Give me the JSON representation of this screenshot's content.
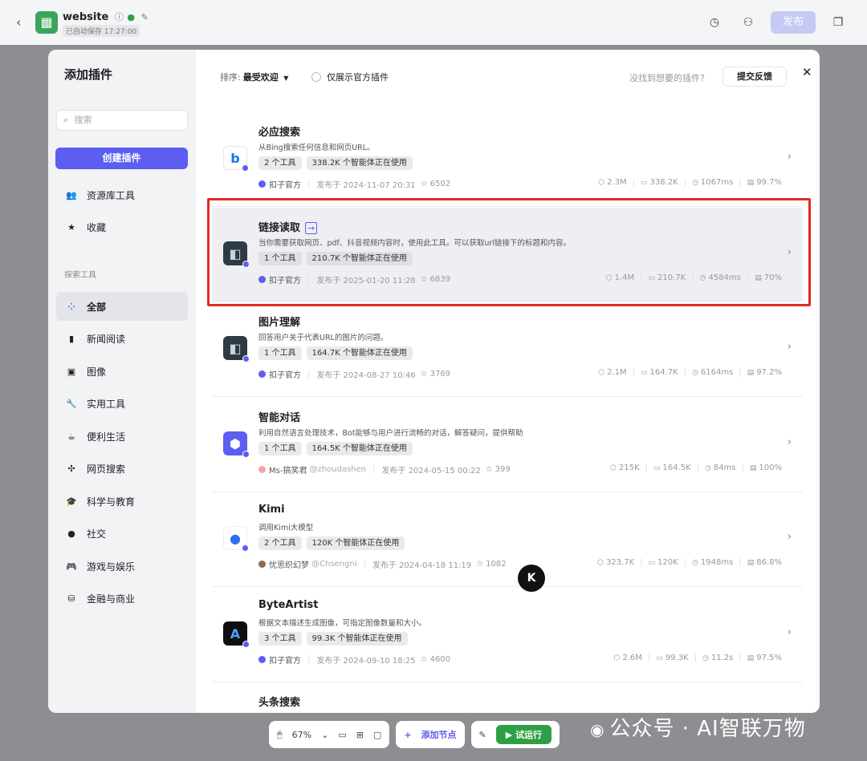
{
  "topbar": {
    "title": "website",
    "autosave": "已自动保存 17:27:00",
    "publish": "发布"
  },
  "sidebar": {
    "heading": "添加插件",
    "search_placeholder": "搜索",
    "create_button": "创建插件",
    "top_items": [
      {
        "label": "资源库工具",
        "icon": "users-icon"
      },
      {
        "label": "收藏",
        "icon": "star-icon"
      }
    ],
    "explore_label": "探索工具",
    "items": [
      {
        "label": "全部",
        "icon": "grid-icon"
      },
      {
        "label": "新闻阅读",
        "icon": "book-icon"
      },
      {
        "label": "图像",
        "icon": "image-icon"
      },
      {
        "label": "实用工具",
        "icon": "wrench-icon"
      },
      {
        "label": "便利生活",
        "icon": "cup-icon"
      },
      {
        "label": "网页搜索",
        "icon": "network-icon"
      },
      {
        "label": "科学与教育",
        "icon": "graduation-cap-icon"
      },
      {
        "label": "社交",
        "icon": "chat-icon"
      },
      {
        "label": "游戏与娱乐",
        "icon": "gamepad-icon"
      },
      {
        "label": "金融与商业",
        "icon": "coins-icon"
      }
    ]
  },
  "header": {
    "sort_label": "排序:",
    "sort_value": "最受欢迎",
    "official_only": "仅展示官方插件",
    "not_found": "没找到想要的插件?",
    "feedback": "提交反馈"
  },
  "plugins": [
    {
      "name": "必应搜索",
      "desc": "从Bing搜索任何信息和网页URL。",
      "tools": "2 个工具",
      "usage": "338.2K 个智能体正在使用",
      "author": "扣子官方",
      "handle": "",
      "published": "发布于 2024-11-07 20:31",
      "stars": "6502",
      "s1": "2.3M",
      "s2": "338.2K",
      "s3": "1067ms",
      "s4": "99.7%",
      "icon": "bing-icon",
      "ext": ""
    },
    {
      "name": "链接读取",
      "desc": "当你需要获取网页、pdf、抖音视频内容时，使用此工具。可以获取url链接下的标题和内容。",
      "tools": "1 个工具",
      "usage": "210.7K 个智能体正在使用",
      "author": "扣子官方",
      "handle": "",
      "published": "发布于 2025-01-20 11:28",
      "stars": "6839",
      "s1": "1.4M",
      "s2": "210.7K",
      "s3": "4584ms",
      "s4": "70%",
      "icon": "robot-icon",
      "ext": "→"
    },
    {
      "name": "图片理解",
      "desc": "回答用户关于代表URL的图片的问题。",
      "tools": "1 个工具",
      "usage": "164.7K 个智能体正在使用",
      "author": "扣子官方",
      "handle": "",
      "published": "发布于 2024-08-27 10:46",
      "stars": "3769",
      "s1": "2.1M",
      "s2": "164.7K",
      "s3": "6164ms",
      "s4": "97.2%",
      "icon": "robot-icon",
      "ext": ""
    },
    {
      "name": "智能对话",
      "desc": "利用自然语言处理技术，Bot能够与用户进行流畅的对话，解答疑问，提供帮助",
      "tools": "1 个工具",
      "usage": "164.5K 个智能体正在使用",
      "author": "Ms-搞笑君",
      "handle": "@zhoudashen",
      "published": "发布于 2024-05-15 00:22",
      "stars": "399",
      "s1": "215K",
      "s2": "164.5K",
      "s3": "84ms",
      "s4": "100%",
      "icon": "cube-icon",
      "ext": ""
    },
    {
      "name": "Kimi",
      "desc": "调用Kimi大模型",
      "tools": "2 个工具",
      "usage": "120K 个智能体正在使用",
      "author": "忧思织幻梦",
      "handle": "@Chsengni",
      "published": "发布于 2024-04-18 11:19",
      "stars": "1082",
      "s1": "323.7K",
      "s2": "120K",
      "s3": "1948ms",
      "s4": "86.8%",
      "icon": "kimi-icon",
      "ext": ""
    },
    {
      "name": "ByteArtist",
      "desc": "根据文本描述生成图像，可指定图像数量和大小。",
      "tools": "3 个工具",
      "usage": "99.3K 个智能体正在使用",
      "author": "扣子官方",
      "handle": "",
      "published": "发布于 2024-09-10 18:25",
      "stars": "4600",
      "s1": "2.6M",
      "s2": "99.3K",
      "s3": "11.2s",
      "s4": "97.5%",
      "icon": "byteartist-icon",
      "ext": ""
    },
    {
      "name": "头条搜索",
      "desc": "",
      "tools": "",
      "usage": "",
      "author": "",
      "handle": "",
      "published": "",
      "stars": "",
      "s1": "",
      "s2": "",
      "s3": "",
      "s4": "",
      "icon": "toutiao-icon",
      "ext": ""
    }
  ],
  "bottombar": {
    "zoom": "67%",
    "add_node": "添加节点",
    "test_run": "试运行"
  },
  "watermark": {
    "text": "公众号 · AI智联万物",
    "logo": "K"
  }
}
